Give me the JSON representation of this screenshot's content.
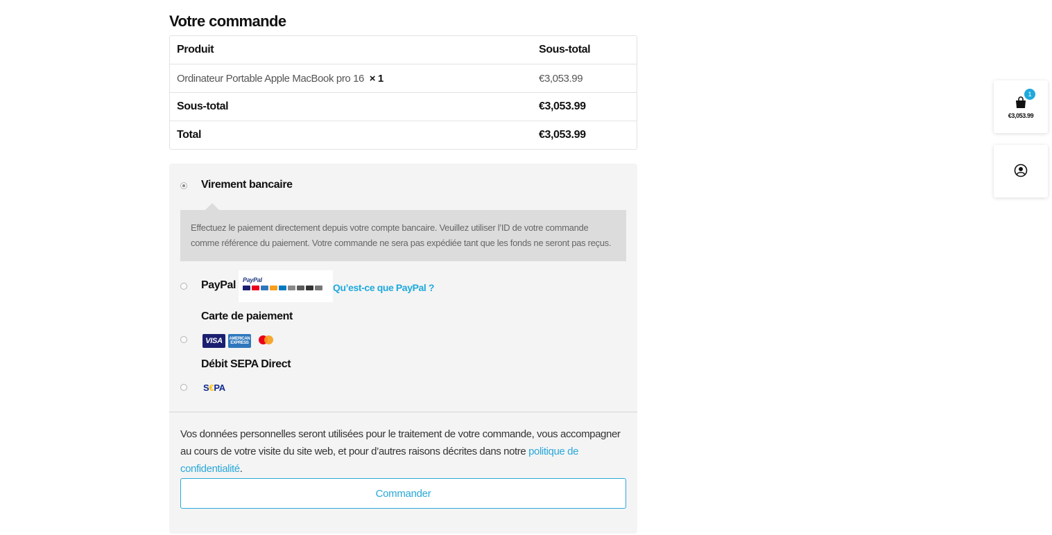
{
  "order": {
    "title": "Votre commande",
    "table": {
      "col_product": "Produit",
      "col_subtotal": "Sous-total",
      "item": {
        "name": "Ordinateur Portable Apple MacBook pro 16",
        "qty": "× 1",
        "price": "€3,053.99"
      },
      "subtotal_label": "Sous-total",
      "subtotal_value": "€3,053.99",
      "total_label": "Total",
      "total_value": "€3,053.99"
    }
  },
  "payment": {
    "methods": [
      {
        "label": "Virement bancaire",
        "selected": true
      },
      {
        "label": "PayPal",
        "selected": false
      },
      {
        "label": "Carte de paiement",
        "selected": false
      },
      {
        "label": "Débit SEPA Direct",
        "selected": false
      }
    ],
    "bank_description": "Effectuez le paiement directement depuis votre compte bancaire. Veuillez utiliser l’ID de votre commande comme référence du paiement. Votre commande ne sera pas expédiée tant que les fonds ne seront pas reçus.",
    "paypal_logo_text": "PayPal",
    "paypal_link": "Qu’est-ce que PayPal ?",
    "card_logos": {
      "visa": "VISA",
      "amex": "AMERICAN EXPRESS"
    },
    "sepa_logo": {
      "part1": "S",
      "part2": "€",
      "part3": "PA"
    }
  },
  "privacy": {
    "text_before": "Vos données personnelles seront utilisées pour le traitement de votre commande, vous accompagner au cours de votre visite du site web, et pour d’autres raisons décrites dans notre ",
    "link": "politique de confidentialité",
    "text_after": "."
  },
  "order_button": "Commander",
  "side": {
    "cart_count": "1",
    "cart_total": "€3,053.99"
  },
  "colors": {
    "accent": "#1fa9dc",
    "box_bg": "#f4f4f4"
  }
}
